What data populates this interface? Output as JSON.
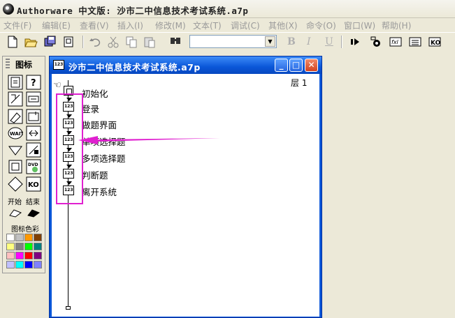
{
  "app": {
    "title": "Authorware 中文版: 沙市二中信息技术考试系统.a7p"
  },
  "menubar": {
    "items": [
      "文件(F)",
      "编辑(E)",
      "查看(V)",
      "插入(I)",
      "修改(M)",
      "文本(T)",
      "调试(C)",
      "其他(X)",
      "命令(O)",
      "窗口(W)",
      "帮助(H)"
    ]
  },
  "toolbar": {
    "buttons": [
      "new-icon",
      "open-icon",
      "save-all-icon",
      "import-icon",
      "undo-icon",
      "cut-icon",
      "copy-icon",
      "paste-icon",
      "find-icon"
    ],
    "style_combo_value": "",
    "format": {
      "bold": "B",
      "italic": "I",
      "underline": "U"
    },
    "right_buttons": [
      "run-icon",
      "control-panel-icon",
      "functions-icon",
      "variables-icon",
      "knowledge-objects-icon"
    ]
  },
  "palette": {
    "title": "图标",
    "start_label": "开始",
    "end_label": "结束",
    "colors_label": "图标色彩",
    "icons": [
      "display-icon",
      "motion-icon",
      "erase-icon",
      "wait-icon",
      "navigate-icon",
      "framework-icon",
      "decision-icon",
      "interaction-icon",
      "calculation-icon",
      "map-icon",
      "digital-movie-icon",
      "sound-icon",
      "dvd-icon",
      "knowledge-object-icon",
      "start-flag-icon",
      "end-flag-icon"
    ],
    "colors": [
      "#ffffff",
      "#c0c0c0",
      "#ff9900",
      "#804000",
      "#ffff80",
      "#808080",
      "#00ff00",
      "#008080",
      "#ffc0c0",
      "#ff00ff",
      "#ff0000",
      "#800080",
      "#c0c0ff",
      "#00ffff",
      "#0000ff",
      "#8080ff"
    ]
  },
  "flowline_window": {
    "title": "沙市二中信息技术考试系统.a7p",
    "level": "层 1",
    "icons": [
      {
        "label": "初始化",
        "type": "calculation-icon"
      },
      {
        "label": "登录",
        "type": "map-icon"
      },
      {
        "label": "做题界面",
        "type": "map-icon"
      },
      {
        "label": "单项选择题",
        "type": "map-icon"
      },
      {
        "label": "多项选择题",
        "type": "map-icon"
      },
      {
        "label": "判断题",
        "type": "map-icon"
      },
      {
        "label": "离开系统",
        "type": "map-icon"
      }
    ],
    "map_icon_text": "123"
  },
  "annotation": {
    "color": "#e020d0"
  }
}
